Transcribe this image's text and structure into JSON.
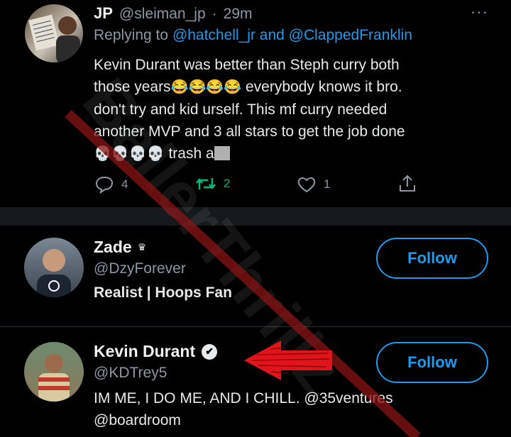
{
  "tweet": {
    "author_name": "JP",
    "author_handle": "@sleiman_jp",
    "separator": "·",
    "time": "29m",
    "more": "···",
    "replying_prefix": "Replying to",
    "replying_users": "@hatchell_jr and @ClappedFranklin",
    "body_line1": "Kevin Durant was better than Steph curry both",
    "body_line2_a": "those years",
    "body_line2_emojis": "😂😂😂😂",
    "body_line2_b": " everybody knows it bro.",
    "body_line3": "don't try and kid urself. This mf curry needed",
    "body_line4": "another MVP and 3 all stars to get the job done",
    "body_line5_emojis": "💀💀💀💀",
    "body_line5_text": "trash a",
    "reply_count": "4",
    "retweet_count": "2",
    "like_count": "1"
  },
  "users": [
    {
      "name": "Zade",
      "badge": "♛",
      "handle": "@DzyForever",
      "bio": "Realist | Hoops Fan",
      "follow_label": "Follow"
    },
    {
      "name": "Kevin Durant",
      "badge": "✔",
      "handle": "@KDTrey5",
      "bio_line1": "IM ME, I DO ME, AND I CHILL. @35ventures",
      "bio_line2": "@boardroom",
      "follow_label": "Follow"
    }
  ],
  "watermark": "BallerThrillz",
  "colors": {
    "background": "#000000",
    "accent": "#1d9bf0",
    "muted": "#8b98a5",
    "retweet_green": "#00ba7c",
    "arrow_red": "#e0141a"
  }
}
